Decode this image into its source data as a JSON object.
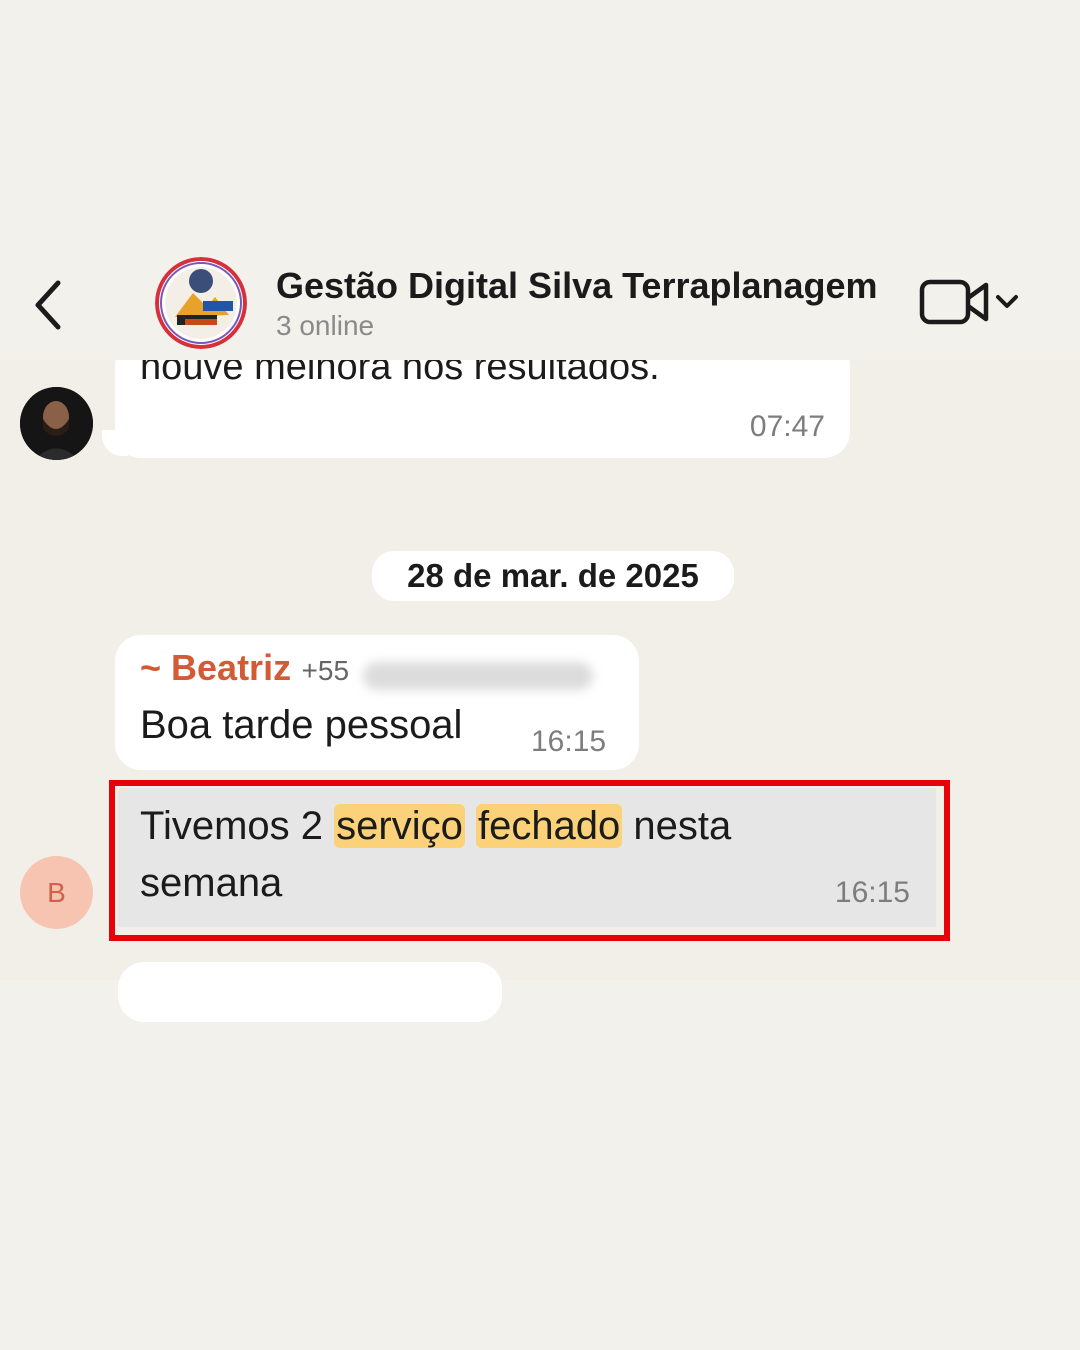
{
  "header": {
    "group_name": "Gestão Digital Silva Terraplanagem",
    "online_status": "3 online",
    "icons": {
      "back": "chevron-left-icon",
      "video": "video-call-icon",
      "dropdown": "chevron-down-icon"
    }
  },
  "messages": [
    {
      "text": "houve  melhora nos resultados.",
      "time": "07:47",
      "avatar": "user-photo"
    },
    {
      "date_separator": "28 de mar. de 2025"
    },
    {
      "sender": "~ Beatriz",
      "phone_prefix": "+55",
      "text": "Boa tarde pessoal",
      "time": "16:15"
    },
    {
      "text_parts": [
        "Tivemos 2 ",
        "serviço",
        " ",
        "fechado",
        " nesta semana"
      ],
      "time": "16:15",
      "avatar_initial": "B",
      "highlighted_words": [
        "serviço",
        "fechado"
      ]
    }
  ],
  "colors": {
    "sender_name": "#d25a34",
    "highlight": "#fbd27a",
    "highlight_box": "#e8000b",
    "avatar_b_bg": "#f8c4b2"
  }
}
